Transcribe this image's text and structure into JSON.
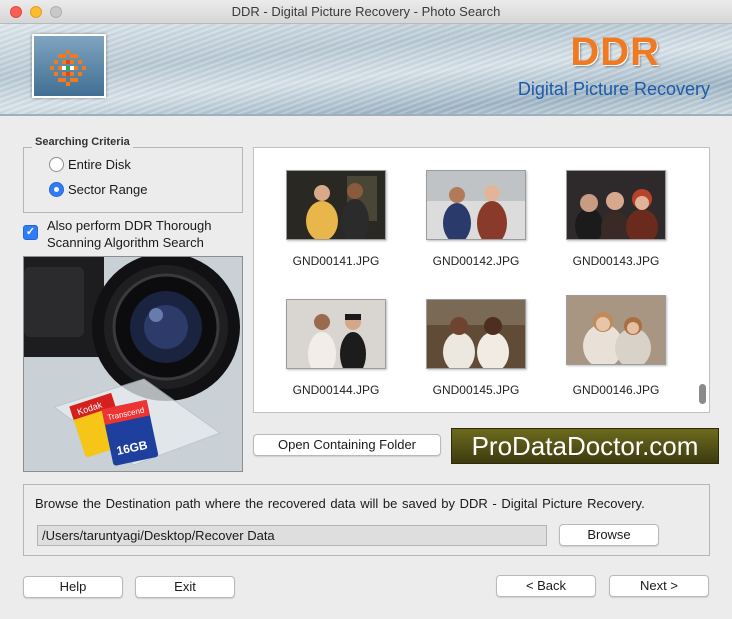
{
  "window": {
    "title": "DDR - Digital Picture Recovery - Photo Search"
  },
  "banner": {
    "brand": "DDR",
    "subtitle": "Digital Picture Recovery"
  },
  "search_criteria": {
    "title": "Searching Criteria",
    "options": [
      {
        "label": "Entire Disk",
        "selected": false
      },
      {
        "label": "Sector Range",
        "selected": true
      }
    ],
    "thorough_label": "Also perform DDR Thorough Scanning Algorithm Search",
    "thorough_checked": true
  },
  "camera": {
    "card_brand_1": "Kodak",
    "card_brand_2": "Transcend",
    "card_size": "16GB"
  },
  "results": {
    "files": [
      {
        "name": "GND00141.JPG"
      },
      {
        "name": "GND00142.JPG"
      },
      {
        "name": "GND00143.JPG"
      },
      {
        "name": "GND00144.JPG"
      },
      {
        "name": "GND00145.JPG"
      },
      {
        "name": "GND00146.JPG"
      }
    ]
  },
  "open_folder_label": "Open Containing Folder",
  "promo": "ProDataDoctor.com",
  "destination": {
    "description": "Browse the Destination path where the recovered data will be saved by DDR - Digital Picture Recovery.",
    "path": "/Users/taruntyagi/Desktop/Recover Data",
    "browse_label": "Browse"
  },
  "footer": {
    "help": "Help",
    "exit": "Exit",
    "back": "< Back",
    "next": "Next >"
  }
}
